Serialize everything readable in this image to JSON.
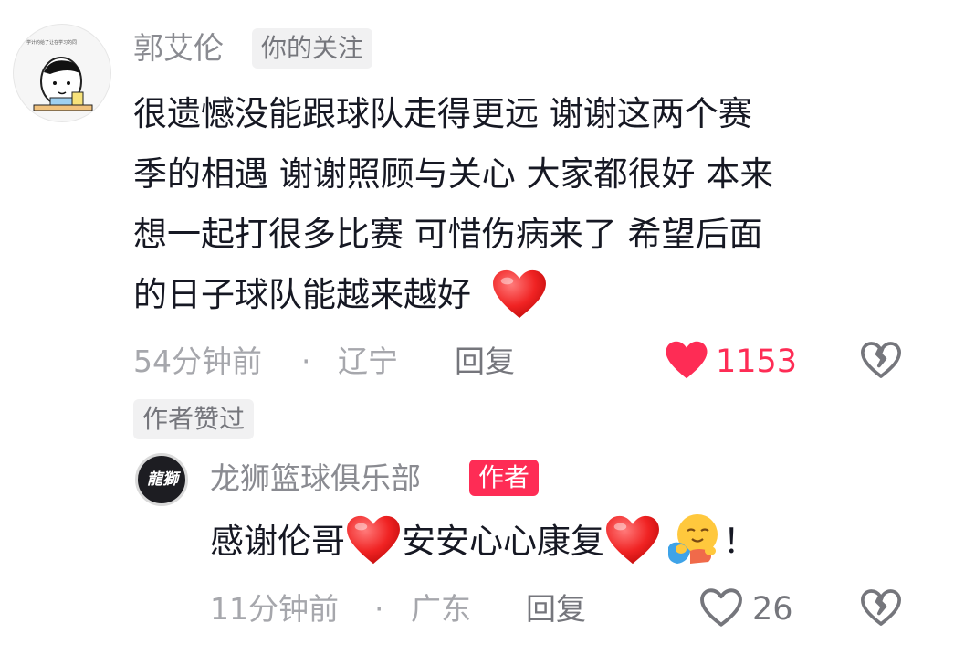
{
  "comment": {
    "username": "郭艾伦",
    "follow_tag": "你的关注",
    "avatar_caption": "学计的给了让在学习的同",
    "text_lines": [
      "很遗憾没能跟球队走得更远 谢谢这两个赛",
      "季的相遇 谢谢照顾与关心 大家都很好 本来",
      "想一起打很多比赛 可惜伤病来了 希望后面",
      "的日子球队能越来越好"
    ],
    "time": "54分钟前",
    "separator": "·",
    "location": "辽宁",
    "reply_label": "回复",
    "like_count": "1153",
    "liked_by_author_tag": "作者赞过",
    "colors": {
      "like_active": "#fe2c55",
      "gray_text": "#a6a7ac"
    }
  },
  "reply": {
    "username": "龙狮篮球俱乐部",
    "author_tag": "作者",
    "avatar_text": "龍獅",
    "text_parts": [
      "感谢伦哥",
      "安安心心康复",
      "！"
    ],
    "time": "11分钟前",
    "separator": "·",
    "location": "广东",
    "reply_label": "回复",
    "like_count": "26"
  },
  "icons": {
    "heart_emoji": "red-heart-emoji",
    "hug_emoji": "hugging-face-emoji",
    "like_filled": "heart-filled-icon",
    "like_outline": "heart-outline-icon",
    "dislike": "broken-heart-icon"
  }
}
